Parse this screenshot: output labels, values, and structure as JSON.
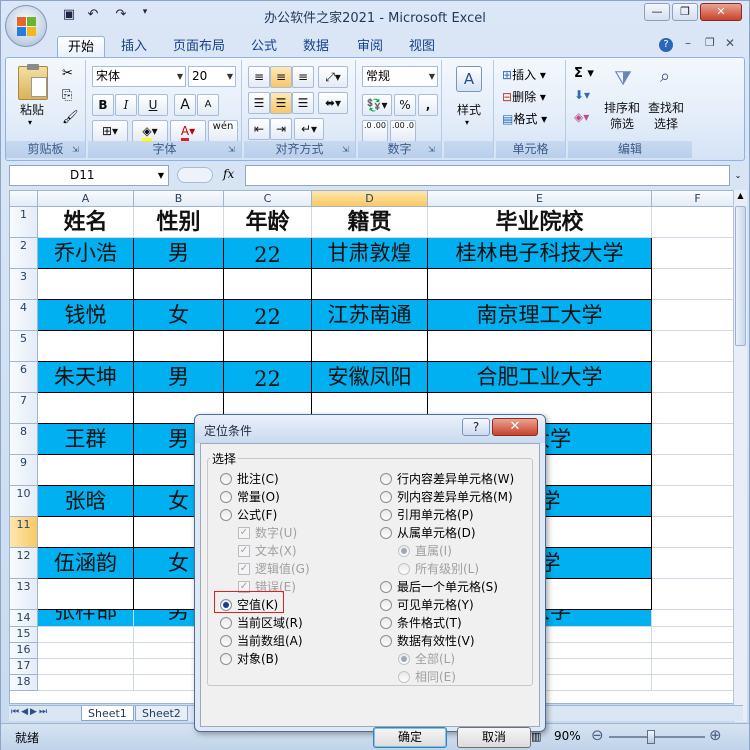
{
  "window": {
    "title": "办公软件之家2021 - Microsoft Excel",
    "controls": {
      "minimize": "—",
      "restore": "❐",
      "close": "✕"
    }
  },
  "ribbon": {
    "tabs": [
      "开始",
      "插入",
      "页面布局",
      "公式",
      "数据",
      "审阅",
      "视图"
    ],
    "active_tab": "开始",
    "clipboard": {
      "paste": "粘贴",
      "label": "剪贴板"
    },
    "font": {
      "name": "宋体",
      "size": "20",
      "label": "字体",
      "bold": "B",
      "italic": "I",
      "underline": "U",
      "grow": "A",
      "shrink": "A",
      "wen": "wén"
    },
    "alignment": {
      "label": "对齐方式"
    },
    "number": {
      "format": "常规",
      "percent": "%",
      "comma": ",",
      "inc": ".0 .00",
      "dec": ".00 .0",
      "label": "数字"
    },
    "styles": {
      "label": "样式"
    },
    "cells": {
      "insert": "插入",
      "delete": "删除",
      "format": "格式",
      "label": "单元格"
    },
    "editing": {
      "sort": "排序和\n筛选",
      "find": "查找和\n选择",
      "sigma": "Σ",
      "label": "编辑"
    }
  },
  "formula_bar": {
    "name_box": "D11",
    "fx": "fx",
    "value": ""
  },
  "sheet": {
    "columns": [
      "A",
      "B",
      "C",
      "D",
      "E",
      "F"
    ],
    "selected_col": "D",
    "rows": [
      "1",
      "2",
      "3",
      "4",
      "5",
      "6",
      "7",
      "8",
      "9",
      "10",
      "11",
      "12",
      "13",
      "14",
      "15",
      "16",
      "17",
      "18"
    ],
    "selected_row": "11",
    "header": [
      "姓名",
      "性别",
      "年龄",
      "籍贯",
      "毕业院校"
    ],
    "data": [
      [
        "乔小浩",
        "男",
        "22",
        "甘肃敦煌",
        "桂林电子科技大学"
      ],
      [
        "钱悦",
        "女",
        "22",
        "江苏南通",
        "南京理工大学"
      ],
      [
        "朱天坤",
        "男",
        "22",
        "安徽凤阳",
        "合肥工业大学"
      ],
      [
        "王群",
        "男",
        "",
        "",
        "工大学"
      ],
      [
        "张晗",
        "女",
        "",
        "",
        "大学"
      ],
      [
        "伍涵韵",
        "女",
        "",
        "",
        "大学"
      ],
      [
        "张梓邯",
        "男",
        "",
        "",
        "工大学"
      ]
    ],
    "tabs": [
      "Sheet1",
      "Sheet2"
    ]
  },
  "status": {
    "ready": "就绪",
    "zoom": "90%",
    "zoom_minus": "⊖",
    "zoom_plus": "⊕"
  },
  "dialog": {
    "title": "定位条件",
    "help": "?",
    "close": "✕",
    "group": "选择",
    "left_options": [
      {
        "label": "批注(C)",
        "type": "radio",
        "checked": false,
        "disabled": false
      },
      {
        "label": "常量(O)",
        "type": "radio",
        "checked": false,
        "disabled": false
      },
      {
        "label": "公式(F)",
        "type": "radio",
        "checked": false,
        "disabled": false
      },
      {
        "label": "数字(U)",
        "type": "check",
        "checked": true,
        "disabled": true
      },
      {
        "label": "文本(X)",
        "type": "check",
        "checked": true,
        "disabled": true
      },
      {
        "label": "逻辑值(G)",
        "type": "check",
        "checked": true,
        "disabled": true
      },
      {
        "label": "错误(E)",
        "type": "check",
        "checked": true,
        "disabled": true
      },
      {
        "label": "空值(K)",
        "type": "radio",
        "checked": true,
        "disabled": false
      },
      {
        "label": "当前区域(R)",
        "type": "radio",
        "checked": false,
        "disabled": false
      },
      {
        "label": "当前数组(A)",
        "type": "radio",
        "checked": false,
        "disabled": false
      },
      {
        "label": "对象(B)",
        "type": "radio",
        "checked": false,
        "disabled": false
      }
    ],
    "right_options": [
      {
        "label": "行内容差异单元格(W)",
        "type": "radio",
        "checked": false,
        "disabled": false
      },
      {
        "label": "列内容差异单元格(M)",
        "type": "radio",
        "checked": false,
        "disabled": false
      },
      {
        "label": "引用单元格(P)",
        "type": "radio",
        "checked": false,
        "disabled": false
      },
      {
        "label": "从属单元格(D)",
        "type": "radio",
        "checked": false,
        "disabled": false
      },
      {
        "label": "直属(I)",
        "type": "radio",
        "checked": true,
        "disabled": true
      },
      {
        "label": "所有级别(L)",
        "type": "radio",
        "checked": false,
        "disabled": true
      },
      {
        "label": "最后一个单元格(S)",
        "type": "radio",
        "checked": false,
        "disabled": false
      },
      {
        "label": "可见单元格(Y)",
        "type": "radio",
        "checked": false,
        "disabled": false
      },
      {
        "label": "条件格式(T)",
        "type": "radio",
        "checked": false,
        "disabled": false
      },
      {
        "label": "数据有效性(V)",
        "type": "radio",
        "checked": false,
        "disabled": false
      },
      {
        "label": "全部(L)",
        "type": "radio",
        "checked": true,
        "disabled": true
      },
      {
        "label": "相同(E)",
        "type": "radio",
        "checked": false,
        "disabled": true
      }
    ],
    "ok": "确定",
    "cancel": "取消"
  },
  "colors": {
    "cell_fill": "#00b0f0",
    "highlight": "#e02020",
    "selected_header": "#f9c862"
  }
}
